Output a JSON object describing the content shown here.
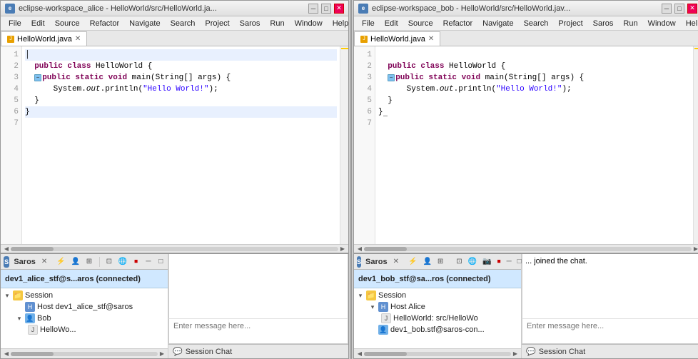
{
  "windows": [
    {
      "id": "alice",
      "title": "eclipse-workspace_alice - HelloWorld/src/HelloWorld.ja...",
      "icon": "e",
      "menus": [
        "File",
        "Edit",
        "Source",
        "Refactor",
        "Navigate",
        "Search",
        "Project",
        "Saros",
        "Run",
        "Window",
        "Help"
      ],
      "editor": {
        "tab_label": "HelloWorld.java",
        "code_lines": [
          {
            "num": "1",
            "content": "│",
            "highlight": true
          },
          {
            "num": "2",
            "content": "  public class HelloWorld {",
            "highlight": false
          },
          {
            "num": "3",
            "content": "    public static void main(String[] args) {",
            "collapse": true,
            "highlight": false
          },
          {
            "num": "4",
            "content": "        System.out.println(\"Hello World!\");",
            "highlight": false
          },
          {
            "num": "5",
            "content": "    }",
            "highlight": false
          },
          {
            "num": "6",
            "content": "  }",
            "highlight": true
          },
          {
            "num": "7",
            "content": "",
            "highlight": false
          }
        ]
      },
      "saros": {
        "tab_label": "Saros",
        "session_header": "dev1_alice_stf@s...aros (connected)",
        "session_label": "Session",
        "tree": [
          {
            "indent": 0,
            "type": "section",
            "label": "Session",
            "arrow": "▾"
          },
          {
            "indent": 1,
            "type": "host",
            "label": "Host dev1_alice_stf@saros",
            "arrow": ""
          },
          {
            "indent": 1,
            "type": "user",
            "label": "Bob",
            "arrow": "▾"
          },
          {
            "indent": 2,
            "type": "file",
            "label": "HelloWo...",
            "arrow": ""
          }
        ]
      },
      "chat": {
        "messages": "",
        "input_placeholder": "Enter message here...",
        "tab_label": "Session Chat"
      }
    },
    {
      "id": "bob",
      "title": "eclipse-workspace_bob - HelloWorld/src/HelloWorld.jav...",
      "icon": "e",
      "menus": [
        "File",
        "Edit",
        "Source",
        "Refactor",
        "Navigate",
        "Search",
        "Project",
        "Saros",
        "Run",
        "Window",
        "Help"
      ],
      "editor": {
        "tab_label": "HelloWorld.java",
        "code_lines": [
          {
            "num": "1",
            "content": "",
            "highlight": false
          },
          {
            "num": "2",
            "content": "  public class HelloWorld {",
            "highlight": false
          },
          {
            "num": "3",
            "content": "    public static void main(String[] args) {",
            "collapse": true,
            "highlight": false
          },
          {
            "num": "4",
            "content": "        System.out.println(\"Hello World!\");",
            "highlight": false
          },
          {
            "num": "5",
            "content": "    }",
            "highlight": false
          },
          {
            "num": "6",
            "content": "  }█",
            "highlight": false
          },
          {
            "num": "7",
            "content": "",
            "highlight": false
          }
        ]
      },
      "saros": {
        "tab_label": "Saros",
        "session_header": "dev1_bob_stf@sa...ros (connected)",
        "session_label": "Session",
        "tree": [
          {
            "indent": 0,
            "type": "section",
            "label": "Session",
            "arrow": "▾"
          },
          {
            "indent": 1,
            "type": "host",
            "label": "Host Alice",
            "arrow": ""
          },
          {
            "indent": 2,
            "type": "file",
            "label": "HelloWorld: src/HelloWo",
            "arrow": ""
          },
          {
            "indent": 1,
            "type": "user",
            "label": "dev1_bob.stf@saros-con...",
            "arrow": ""
          }
        ]
      },
      "chat": {
        "messages": "... joined the chat.",
        "input_placeholder": "Enter message here...",
        "tab_label": "Session Chat"
      }
    }
  ],
  "toolbar_icons": {
    "connect": "⚡",
    "contacts": "👤",
    "share": "📤",
    "settings": "⚙",
    "stop": "⏹",
    "minimize": "─",
    "restore": "□"
  }
}
